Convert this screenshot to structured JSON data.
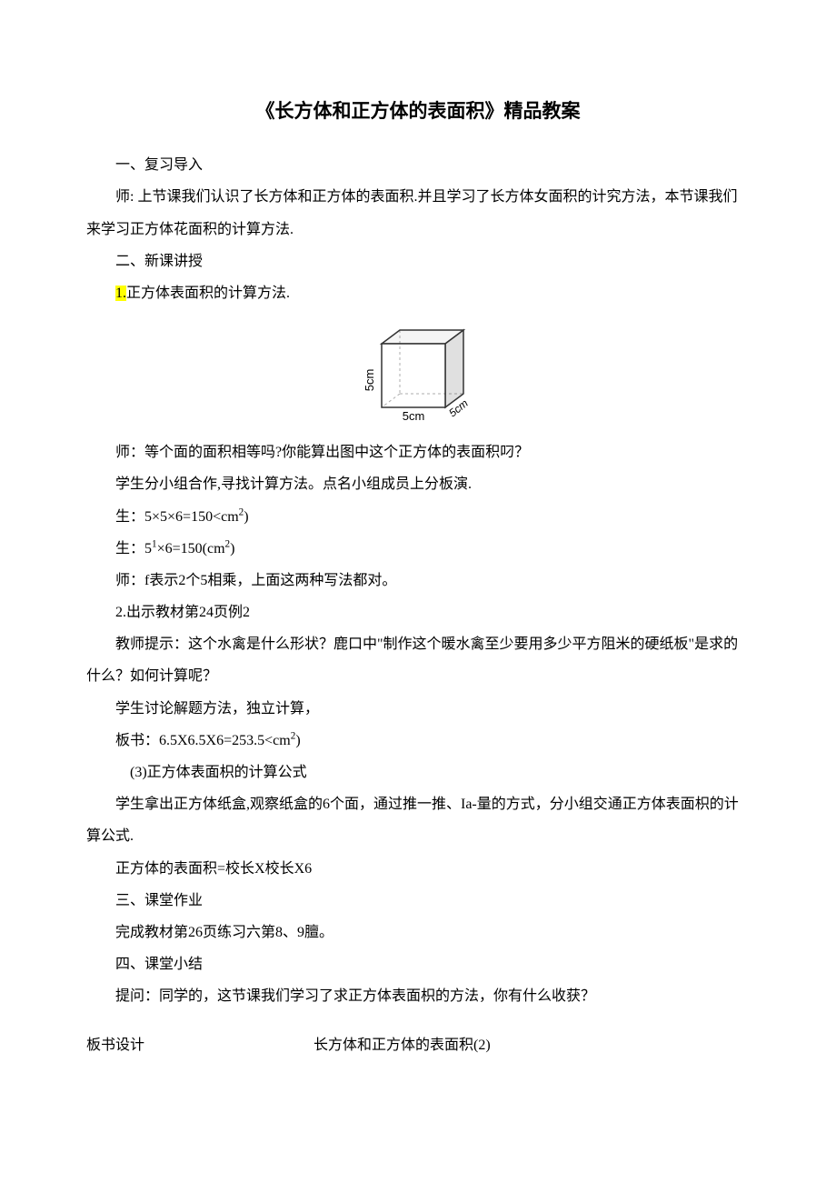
{
  "title": "《长方体和正方体的表面积》精品教案",
  "s1_heading": "一、复习导入",
  "s1_p1": "师: 上节课我们认识了长方体和正方体的表面积.并且学习了长方体女面积的计究方法，本节课我们来学习正方体花面积的计算方法.",
  "s2_heading": "二、新课讲授",
  "s2_item1_prefix": "1.",
  "s2_item1_text": "正方体表面积的计算方法.",
  "cube": {
    "side_label": "5cm",
    "vert_label": "5cm",
    "depth_label": "5cm"
  },
  "s2_p_q": "师：等个面的面积相等吗?你能算出图中这个正方体的表面积叼？",
  "s2_p_group": "学生分小组合作,寻找计算方法。点名小组成员上分板演.",
  "s2_p_calc1_a": "生：5×5×6=150<cm",
  "s2_p_calc1_b": ")",
  "s2_p_calc2_a": "生：5",
  "s2_p_calc2_b": "×6=150(cm",
  "s2_p_calc2_c": ")",
  "s2_p_teacher": "师：f表示2个5相乘，上面这两种写法都对。",
  "s2_item2": "2.出示教材第24页例2",
  "s2_p_hint": "教师提示：这个水禽是什么形状？鹿口中\"制作这个暖水禽至少要用多少平方阻米的硬纸板\"是求的什么？如何计算呢？",
  "s2_p_discuss": "学生讨论解题方法，独立计算，",
  "s2_p_board_a": "板书：6.5X6.5X6=253.5<cm",
  "s2_p_board_b": ")",
  "s2_item3": "(3)正方体表面枳的计算公式",
  "s2_p_box": "学生拿出正方体纸盒,观察纸盒的6个面，通过推一推、Ia-量的方式，分小组交通正方体表面枳的计算公式.",
  "s2_p_formula": "正方体的表面积=校长X校长X6",
  "s3_heading": "三、课堂作业",
  "s3_p1": "完成教材第26页练习六第8、9膻。",
  "s4_heading": "四、课堂小结",
  "s4_p1": "提问：同学的，这节课我们学习了求正方体表面枳的方法，你有什么收获？",
  "board_label": "板书设计",
  "board_title": "长方体和正方体的表面积(2)"
}
